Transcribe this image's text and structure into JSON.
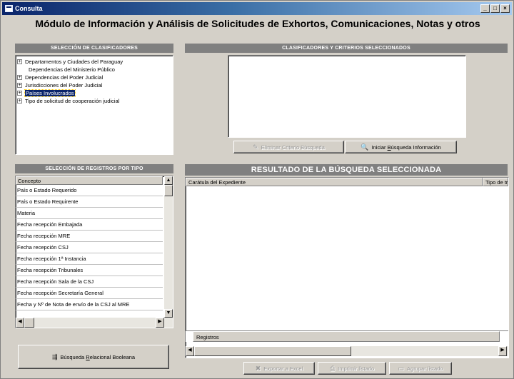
{
  "window": {
    "title": "Consulta",
    "controls": {
      "minimize": "_",
      "maximize": "□",
      "close": "×"
    }
  },
  "heading": "Módulo de Información y Análisis de Solicitudes de Exhortos, Comunicaciones, Notas y otros",
  "clasificadores": {
    "header": "SELECCIÓN DE CLASIFICADORES",
    "tree": [
      {
        "label": "Departamentos y Ciudades del Paraguay",
        "expandable": true,
        "selected": false
      },
      {
        "label": "Dependencias del Ministerio Público",
        "expandable": false,
        "selected": false
      },
      {
        "label": "Dependencias del Poder Judicial",
        "expandable": true,
        "selected": false
      },
      {
        "label": "Jurisdicciones del Poder Judicial",
        "expandable": true,
        "selected": false
      },
      {
        "label": "Países Involucrados",
        "expandable": true,
        "selected": true
      },
      {
        "label": "Tipo de solicitud de cooperación judicial",
        "expandable": true,
        "selected": false
      }
    ]
  },
  "criterios": {
    "header": "CLASIFICADORES Y CRITERIOS SELECCIONADOS",
    "eliminar_button": "Eliminar Criterio Búsqueda",
    "iniciar_button_pre": "Iniciar ",
    "iniciar_button_u": "B",
    "iniciar_button_post": "úsqueda Información"
  },
  "registros": {
    "header": "SELECCIÓN DE REGISTROS POR TIPO",
    "column": "Concepto",
    "items": [
      "País o Estado Requerido",
      "País o Estado Requirente",
      "Materia",
      "Fecha recepción Embajada",
      "Fecha recepción MRE",
      "Fecha recepción CSJ",
      "Fecha recepción 1ª Instancia",
      "Fecha recepción Tribunales",
      "Fecha recepción Sala de la CSJ",
      "Fecha recepción Secretaría General",
      "Fecha y Nº de Nota de envío de la CSJ al MRE"
    ]
  },
  "busqueda_booleana": {
    "pre": "Búsqueda ",
    "u": "R",
    "post": "elacional Booleana"
  },
  "resultado": {
    "header": "RESULTADO DE LA BÚSQUEDA SELECCIONADA",
    "columns": [
      "Carátula del Expediente",
      "Tipo de trá"
    ],
    "footer": "Registros"
  },
  "bottom_buttons": {
    "exportar": "Exportar a Excel",
    "imprimir": "Imprimir listado",
    "agrupar": "Agrupar listado"
  },
  "colors": {
    "titlebar": "#0a246a",
    "window": "#d4d0c8",
    "section_header": "#808080",
    "selection": "#0a246a"
  }
}
